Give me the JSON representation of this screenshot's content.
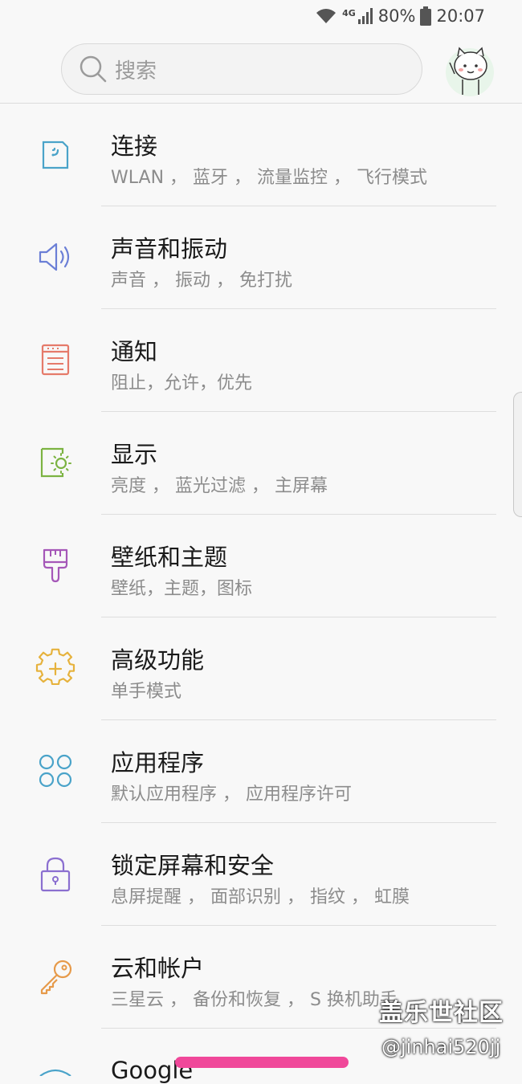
{
  "status": {
    "network": "4G",
    "battery": "80%",
    "time": "20:07"
  },
  "search": {
    "placeholder": "搜索"
  },
  "items": [
    {
      "title": "连接",
      "subtitle": "WLAN ， 蓝牙 ， 流量监控 ， 飞行模式",
      "icon": "connection-icon",
      "color": "#4aa3c9"
    },
    {
      "title": "声音和振动",
      "subtitle": "声音 ， 振动 ， 免打扰",
      "icon": "speaker-icon",
      "color": "#6b7fd6"
    },
    {
      "title": "通知",
      "subtitle": "阻止，允许，优先",
      "icon": "notification-icon",
      "color": "#e57a6a"
    },
    {
      "title": "显示",
      "subtitle": "亮度 ， 蓝光过滤 ， 主屏幕",
      "icon": "display-brightness-icon",
      "color": "#7cb342"
    },
    {
      "title": "壁纸和主题",
      "subtitle": "壁纸，主题，图标",
      "icon": "paintbrush-icon",
      "color": "#a557b8"
    },
    {
      "title": "高级功能",
      "subtitle": "单手模式",
      "icon": "gear-plus-icon",
      "color": "#e6b23c"
    },
    {
      "title": "应用程序",
      "subtitle": "默认应用程序 ， 应用程序许可",
      "icon": "apps-grid-icon",
      "color": "#4aa3c9"
    },
    {
      "title": "锁定屏幕和安全",
      "subtitle": "息屏提醒 ， 面部识别 ， 指纹 ， 虹膜",
      "icon": "lock-icon",
      "color": "#8b6fd0"
    },
    {
      "title": "云和帐户",
      "subtitle": "三星云 ， 备份和恢复 ， S 换机助手",
      "icon": "key-icon",
      "color": "#e69a4a"
    }
  ],
  "partial_item": {
    "title": "Google"
  },
  "watermark": {
    "line1": "盖乐世社区",
    "line2": "@jinhai520jj"
  }
}
